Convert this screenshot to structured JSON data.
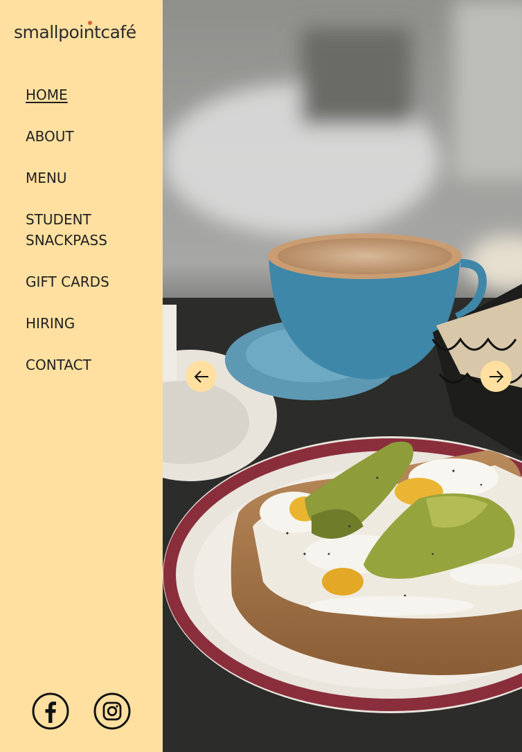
{
  "brand": {
    "logo_text": "smallpointcafé",
    "logo_accent": "#d9642e"
  },
  "colors": {
    "sidebar_bg": "#ffe0a0",
    "text": "#1f1f1f"
  },
  "nav": {
    "items": [
      {
        "label": "HOME",
        "active": true
      },
      {
        "label": "ABOUT"
      },
      {
        "label": "MENU"
      },
      {
        "label": "STUDENT SNACKPASS"
      },
      {
        "label": "GIFT CARDS"
      },
      {
        "label": "HIRING"
      },
      {
        "label": "CONTACT"
      }
    ]
  },
  "social": {
    "icons": [
      "facebook-icon",
      "instagram-icon"
    ]
  },
  "slideshow": {
    "controls": [
      "arrow-left-icon",
      "arrow-right-icon"
    ]
  }
}
